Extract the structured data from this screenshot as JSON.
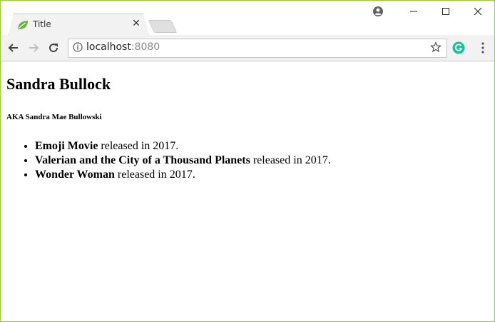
{
  "browser": {
    "tab": {
      "title": "Title"
    },
    "address_bar": {
      "host": "localhost",
      "port": ":8080"
    }
  },
  "page": {
    "heading": "Sandra Bullock",
    "aka": "AKA Sandra Mae Bullowski",
    "movies": [
      {
        "title": "Emoji Movie",
        "suffix": " released in 2017."
      },
      {
        "title": "Valerian and the City of a Thousand Planets",
        "suffix": " released in 2017."
      },
      {
        "title": "Wonder Woman",
        "suffix": " released in 2017."
      }
    ]
  },
  "colors": {
    "window_border": "#9acd32",
    "grammarly": "#15c39a",
    "favicon": "#6db33f"
  },
  "icons": {
    "favicon": "spring-leaf-icon",
    "close": "close-icon",
    "profile": "profile-icon",
    "minimize": "minimize-icon",
    "maximize": "maximize-icon",
    "window_close": "window-close-icon",
    "back": "back-arrow-icon",
    "forward": "forward-arrow-icon",
    "reload": "reload-icon",
    "info": "info-icon",
    "star": "star-icon",
    "grammarly": "grammarly-icon",
    "menu": "kebab-menu-icon"
  }
}
